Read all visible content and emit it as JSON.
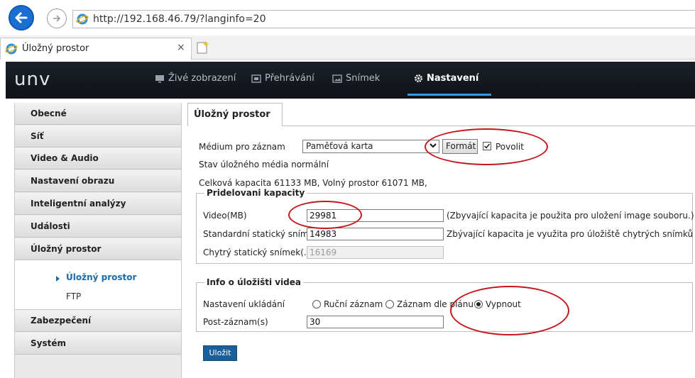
{
  "browser": {
    "url": "http://192.168.46.79/?langinfo=20",
    "tab_title": "Úložný prostor",
    "tab_close": "×"
  },
  "app": {
    "logo": "unv",
    "nav": [
      {
        "label": "Živé zobrazení",
        "icon": "monitor-icon"
      },
      {
        "label": "Přehrávání",
        "icon": "film-icon"
      },
      {
        "label": "Snímek",
        "icon": "picture-icon"
      },
      {
        "label": "Nastavení",
        "icon": "gear-icon",
        "active": true
      }
    ]
  },
  "sidebar": {
    "items": [
      {
        "label": "Obecné"
      },
      {
        "label": "Síť"
      },
      {
        "label": "Video & Audio"
      },
      {
        "label": "Nastavení obrazu"
      },
      {
        "label": "Inteligentní analýzy"
      },
      {
        "label": "Události"
      },
      {
        "label": "Úložný prostor"
      },
      {
        "label": "Zabezpečení"
      },
      {
        "label": "Systém"
      }
    ],
    "sub_items": [
      {
        "label": "Úložný prostor",
        "active": true
      },
      {
        "label": "FTP"
      }
    ]
  },
  "content": {
    "tab": "Úložný prostor",
    "medium_label": "Médium pro záznam",
    "medium_value": "Paměťová karta",
    "format_button": "Formát",
    "enable_label": "Povolit",
    "enable_checked": true,
    "status_text": "Stav úložného média normální",
    "capacity_text": "Celková kapacita  61133 MB, Volný prostor 61071 MB,",
    "allocation": {
      "legend": "Pridelovani kapacity",
      "video_label": "Video(MB)",
      "video_value": "29981",
      "video_note": "(Zbyvající kapacita je použita pro uložení image souboru.)",
      "standard_label": "Standardní statický sním...",
      "standard_value": "14983",
      "standard_note": "Zbývající kapacita je využita pro úložiště chytrých snímků",
      "smart_label": "Chytrý statický snímek(...",
      "smart_value": "16169"
    },
    "video_storage": {
      "legend": "Info o úložišti videa",
      "save_label": "Nastavení ukládání",
      "options": [
        "Ruční záznam",
        "Záznam dle plánu",
        "Vypnout"
      ],
      "selected": "Vypnout",
      "post_label": "Post-záznam(s)",
      "post_value": "30"
    },
    "save_button": "Uložit"
  },
  "colors": {
    "header_bg": "#14181f",
    "accent": "#3a9ad9",
    "save_button": "#1a5f99",
    "annotation": "#c4161c"
  }
}
